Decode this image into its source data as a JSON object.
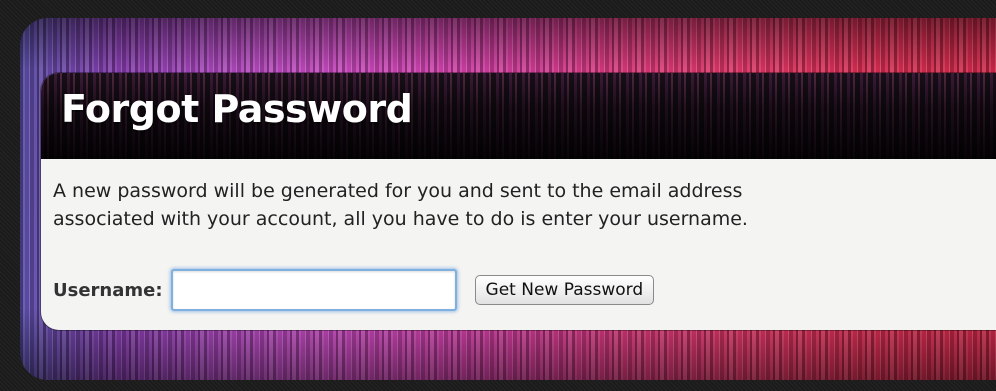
{
  "panel": {
    "title": "Forgot Password",
    "description_line1": "A new password will be generated for you and sent to the email address",
    "description_line2": "associated with your account, all you have to do is enter your username."
  },
  "form": {
    "username_label": "Username:",
    "username_value": "",
    "username_placeholder": "",
    "submit_label": "Get New Password"
  },
  "colors": {
    "accent_focus": "#7fb0e0",
    "panel_background": "#f4f4f2",
    "header_text": "#ffffff"
  }
}
